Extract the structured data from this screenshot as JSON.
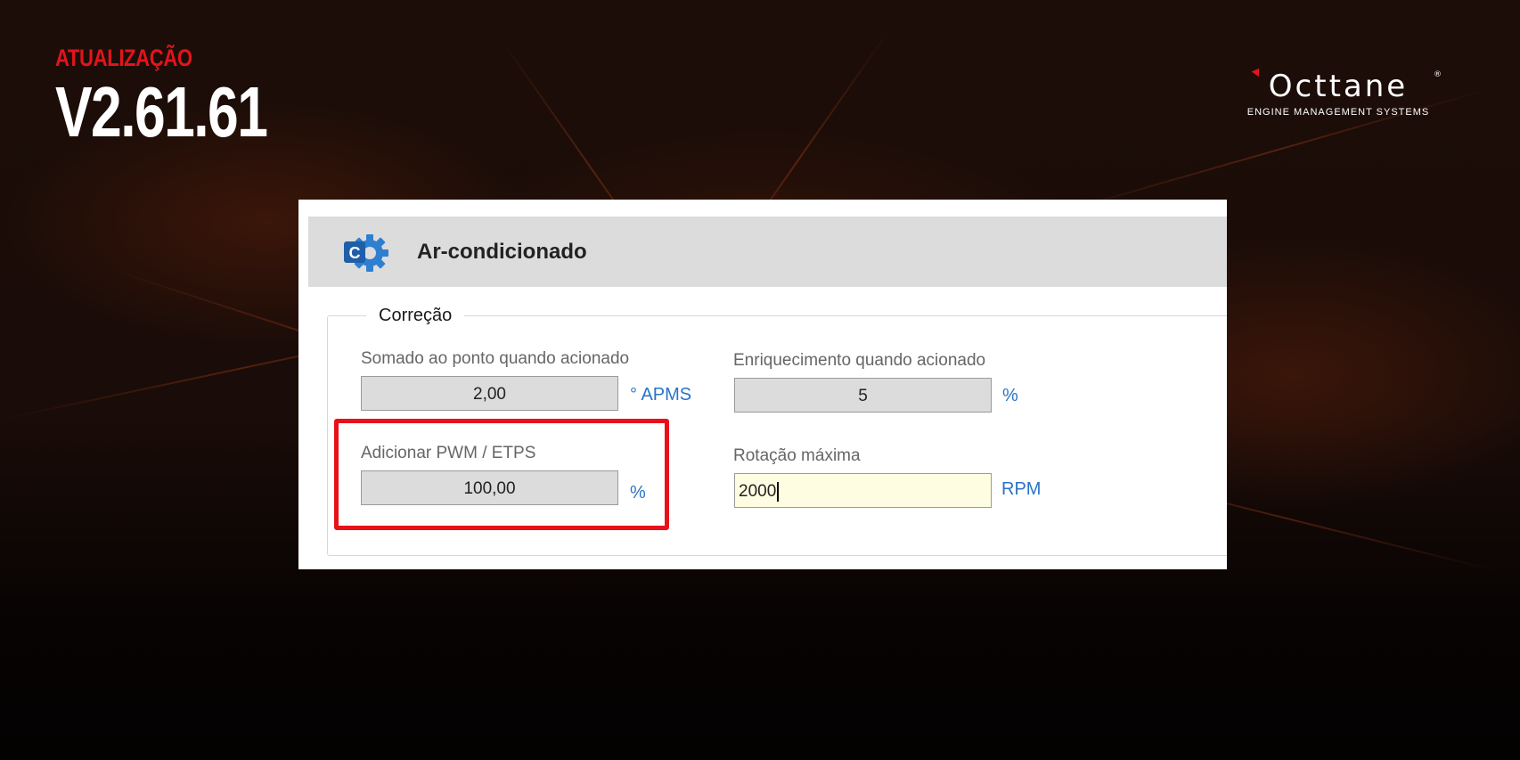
{
  "banner": {
    "update_label": "ATUALIZAÇÃO",
    "version": "V2.61.61"
  },
  "logo": {
    "wordmark": "Octtane",
    "registered": "®",
    "tagline": "ENGINE MANAGEMENT SYSTEMS"
  },
  "window": {
    "title": "Ar-condicionado",
    "icon": "gear-c-icon",
    "group_title": "Correção",
    "fields": {
      "somado": {
        "label": "Somado ao ponto quando acionado",
        "value": "2,00",
        "unit": "° APMS"
      },
      "enriquecimento": {
        "label": "Enriquecimento quando acionado",
        "value": "5",
        "unit": "%"
      },
      "pwm": {
        "label": "Adicionar PWM / ETPS",
        "value": "100,00",
        "unit": "%"
      },
      "rotacao": {
        "label": "Rotação máxima",
        "value": "2000",
        "unit": "RPM"
      }
    }
  },
  "colors": {
    "accent_red": "#e3141b",
    "unit_blue": "#2a73c8",
    "active_field": "#fffde1"
  }
}
